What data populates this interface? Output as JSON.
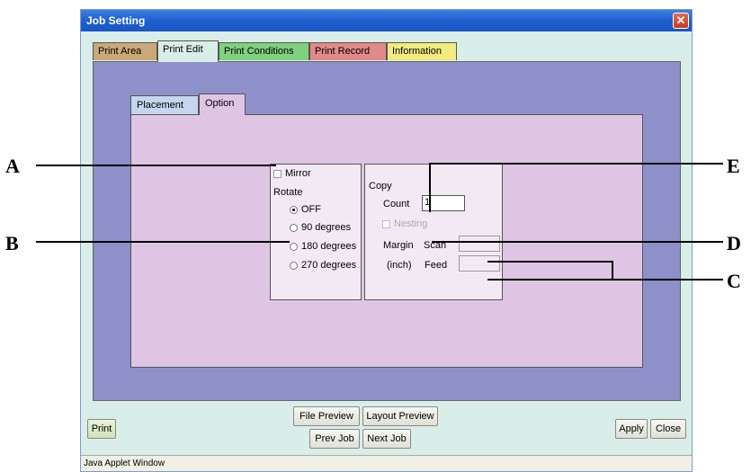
{
  "window": {
    "title": "Job Setting",
    "close_glyph": "✕"
  },
  "tabs": [
    {
      "label": "Print Area",
      "color": "#c9a97a"
    },
    {
      "label": "Print Edit",
      "color": "#d9eee8"
    },
    {
      "label": "Print Conditions",
      "color": "#7fd07f"
    },
    {
      "label": "Print Record",
      "color": "#e28989"
    },
    {
      "label": "Information",
      "color": "#f2ec80"
    }
  ],
  "subtabs": [
    {
      "label": "Placement",
      "color": "#c6d6ef"
    },
    {
      "label": "Option",
      "color": "#dfc5e4"
    }
  ],
  "option": {
    "mirror_label": "Mirror",
    "mirror_checked": false,
    "rotate_label": "Rotate",
    "rotate_options": [
      "OFF",
      "90 degrees",
      "180 degrees",
      "270 degrees"
    ],
    "rotate_selected": "OFF",
    "copy_label": "Copy",
    "count_label": "Count",
    "count_value": "1",
    "nesting_label": "Nesting",
    "margin_label": "Margin",
    "inch_label": "(inch)",
    "scan_label": "Scan",
    "feed_label": "Feed",
    "scan_value": "",
    "feed_value": ""
  },
  "buttons": {
    "print": "Print",
    "file_preview": "File Preview",
    "layout_preview": "Layout Preview",
    "prev_job": "Prev Job",
    "next_job": "Next Job",
    "apply": "Apply",
    "close": "Close"
  },
  "status": "Java Applet Window",
  "callouts": {
    "a": "A",
    "b": "B",
    "c": "C",
    "d": "D",
    "e": "E"
  }
}
